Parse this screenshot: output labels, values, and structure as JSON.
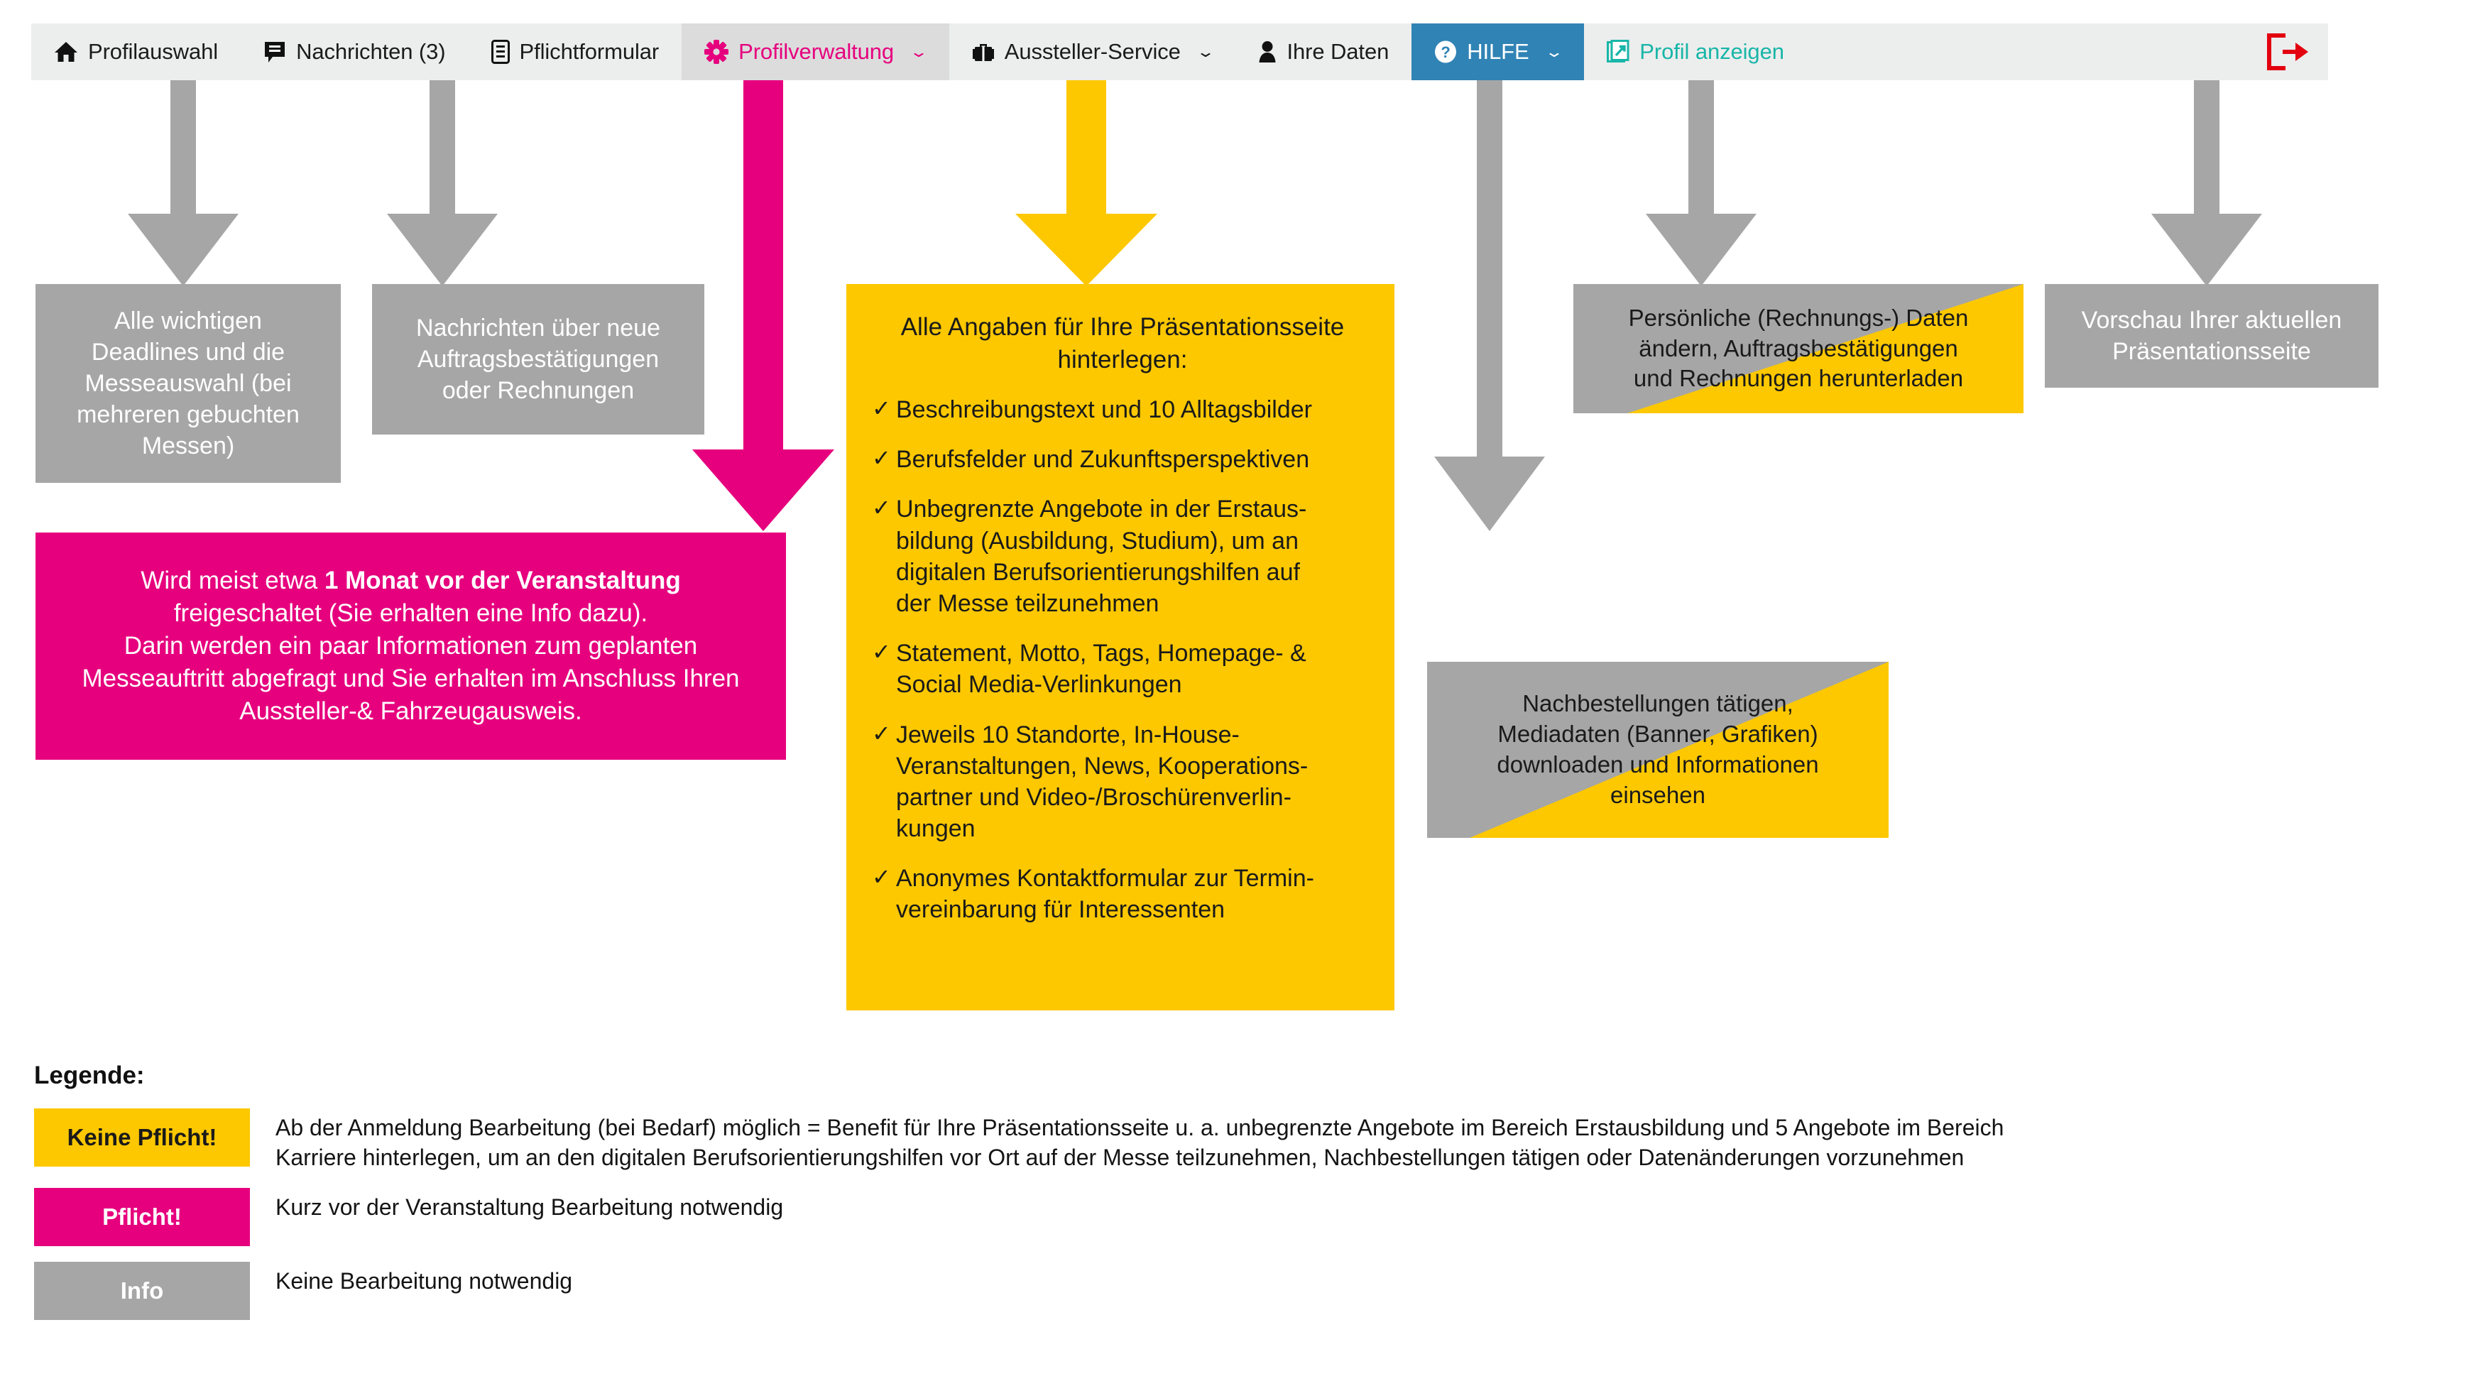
{
  "nav": {
    "items": [
      {
        "label": "Profilauswahl",
        "icon": "home-icon",
        "state": "default",
        "caret": false
      },
      {
        "label": "Nachrichten (3)",
        "icon": "message-icon",
        "state": "default",
        "caret": false
      },
      {
        "label": "Pflichtformular",
        "icon": "form-icon",
        "state": "default",
        "caret": false
      },
      {
        "label": "Profilverwaltung",
        "icon": "gear-icon",
        "state": "active",
        "caret": true
      },
      {
        "label": "Aussteller-Service",
        "icon": "briefcase-icon",
        "state": "default",
        "caret": true
      },
      {
        "label": "Ihre Daten",
        "icon": "user-icon",
        "state": "default",
        "caret": false
      },
      {
        "label": "HILFE",
        "icon": "question-circle-icon",
        "state": "help",
        "caret": true
      },
      {
        "label": "Profil anzeigen",
        "icon": "external-window-icon",
        "state": "preview",
        "caret": false
      }
    ],
    "logout_icon": "logout-icon"
  },
  "boxes": {
    "profilauswahl": {
      "lines": [
        "Alle wichtigen",
        "Deadlines und die",
        "Messeauswahl (bei",
        "mehreren gebuchten",
        "Messen)"
      ],
      "style": "Info"
    },
    "nachrichten": {
      "lines": [
        "Nachrichten über neue",
        "Auftragsbestätigungen",
        "oder Rechnungen"
      ],
      "style": "Info"
    },
    "pflichtformular": {
      "lines_html": [
        "Wird meist etwa <b>1 Monat vor der Veranstaltung</b>",
        "freigeschaltet (Sie erhalten eine Info dazu).",
        "Darin werden ein paar Informationen zum geplanten",
        "Messeauftritt abgefragt und Sie erhalten im Anschluss Ihren",
        "Aussteller-&amp; Fahrzeugausweis."
      ],
      "style": "Pflicht"
    },
    "profilverwaltung": {
      "headline": "Alle Angaben für Ihre Präsentationsseite hinterlegen:",
      "check_symbol": "✓",
      "items": [
        "Beschreibungstext und 10 Alltagsbilder",
        "Berufsfelder und Zukunftsperspektiven",
        "Unbegrenzte Angebote in der Erstaus-bildung (Ausbildung, Studium), um an digitalen Berufsorientierungshilfen auf der Messe teilzunehmen",
        "Statement, Motto, Tags, Homepage- & Social Media-Verlinkungen",
        "Jeweils 10 Standorte, In-House-Veranstaltungen, News, Kooperations-partner und Video-/Broschürenverlin-kungen",
        "Anonymes Kontaktformular zur Termin-vereinbarung für Interessenten"
      ],
      "items_lines": [
        [
          "Beschreibungstext und 10 Alltagsbilder"
        ],
        [
          "Berufsfelder und Zukunftsperspektiven"
        ],
        [
          "Unbegrenzte Angebote in der Erstaus-",
          "bildung (Ausbildung, Studium), um an",
          "digitalen Berufsorientierungshilfen auf",
          "der Messe teilzunehmen"
        ],
        [
          "Statement, Motto, Tags, Homepage- &",
          "Social Media-Verlinkungen"
        ],
        [
          "Jeweils 10 Standorte, In-House-",
          "Veranstaltungen, News, Kooperations-",
          "partner und Video-/Broschürenverlin-",
          "kungen"
        ],
        [
          "Anonymes Kontaktformular zur Termin-",
          "vereinbarung für Interessenten"
        ]
      ],
      "style": "Keine Pflicht"
    },
    "aussteller_service": {
      "lines": [
        "Nachbestellungen tätigen,",
        "Mediadaten (Banner, Grafiken)",
        "downloaden und Informationen",
        "einsehen"
      ],
      "style": "Info + Keine Pflicht"
    },
    "ihre_daten": {
      "lines": [
        "Persönliche (Rechnungs-) Daten",
        "ändern, Auftragsbestätigungen",
        "und Rechnungen herunterladen"
      ],
      "style": "Info + Keine Pflicht"
    },
    "profil_anzeigen": {
      "lines": [
        "Vorschau Ihrer aktuellen",
        "Präsentationsseite"
      ],
      "style": "Info"
    }
  },
  "legend": {
    "title": "Legende:",
    "rows": [
      {
        "chip": "Keine Pflicht!",
        "chip_style": "yellow",
        "lines": [
          "Ab der Anmeldung Bearbeitung (bei Bedarf) möglich = Benefit für Ihre Präsentationsseite u. a. unbegrenzte Angebote im Bereich Erstausbildung und 5 Angebote im Bereich",
          "Karriere hinterlegen, um an den digitalen Berufsorientierungshilfen vor Ort auf der Messe teilzunehmen, Nachbestellungen tätigen oder Datenänderungen vorzunehmen"
        ]
      },
      {
        "chip": "Pflicht!",
        "chip_style": "pink",
        "lines": [
          "Kurz vor der Veranstaltung Bearbeitung notwendig"
        ]
      },
      {
        "chip": "Info",
        "chip_style": "gray",
        "lines": [
          "Keine Bearbeitung notwendig"
        ]
      }
    ]
  },
  "colors": {
    "pink": "#e6007e",
    "yellow": "#fdc800",
    "gray": "#a6a6a6",
    "help_blue": "#3083b5",
    "preview_teal": "#18b6a8",
    "logout_red": "#e3000f",
    "navbar_bg": "#eceded",
    "active_tab_bg": "#dcdcdc"
  }
}
